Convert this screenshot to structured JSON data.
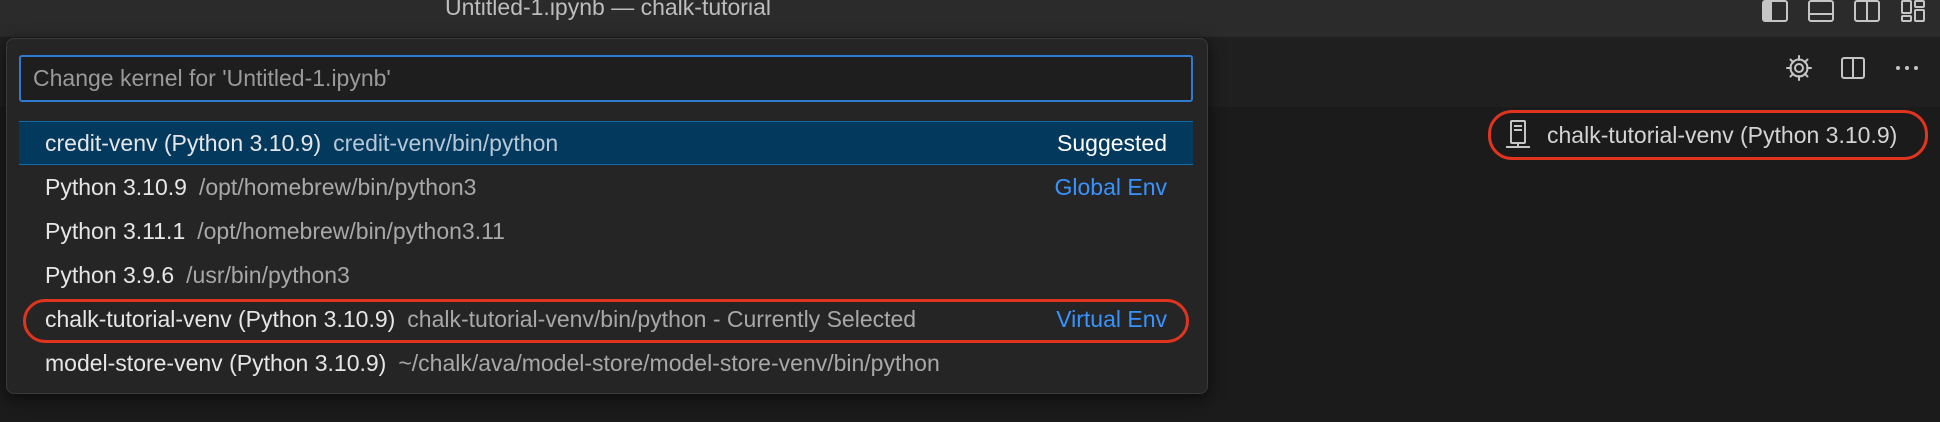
{
  "window": {
    "title": "Untitled-1.ipynb — chalk-tutorial"
  },
  "titlebar_icons": [
    "toggle-primary-sidebar-icon",
    "toggle-panel-icon",
    "toggle-secondary-sidebar-icon",
    "customize-layout-icon"
  ],
  "toolbar": {
    "icons": [
      "gear-icon",
      "split-editor-icon",
      "more-actions-icon"
    ]
  },
  "kernel_badge": {
    "label": "chalk-tutorial-venv (Python 3.10.9)",
    "icon": "kernel-server-icon"
  },
  "quick_pick": {
    "placeholder": "Change kernel for 'Untitled-1.ipynb'",
    "items": [
      {
        "name": "credit-venv (Python 3.10.9)",
        "path": "credit-venv/bin/python",
        "tag": "Suggested"
      },
      {
        "name": "Python 3.10.9",
        "path": "/opt/homebrew/bin/python3",
        "tag": "Global Env"
      },
      {
        "name": "Python 3.11.1",
        "path": "/opt/homebrew/bin/python3.11",
        "tag": ""
      },
      {
        "name": "Python 3.9.6",
        "path": "/usr/bin/python3",
        "tag": ""
      },
      {
        "name": "chalk-tutorial-venv (Python 3.10.9)",
        "path": "chalk-tutorial-venv/bin/python - Currently Selected",
        "tag": "Virtual Env"
      },
      {
        "name": "model-store-venv (Python 3.10.9)",
        "path": "~/chalk/ava/model-store/model-store-venv/bin/python",
        "tag": ""
      }
    ]
  },
  "colors": {
    "accent": "#3794ff",
    "selection": "#04395e",
    "highlight_circle": "#e0341e",
    "focus_border": "#2f7bd0"
  }
}
